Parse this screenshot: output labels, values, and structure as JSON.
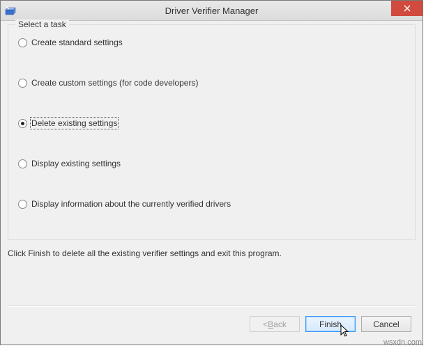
{
  "window": {
    "title": "Driver Verifier Manager"
  },
  "group": {
    "legend": "Select a task"
  },
  "options": {
    "create_standard": "Create standard settings",
    "create_custom": "Create custom settings (for code developers)",
    "delete_existing": "Delete existing settings",
    "display_existing": "Display existing settings",
    "display_info": "Display information about the currently verified drivers",
    "selected": "delete_existing"
  },
  "help": "Click Finish to delete all the existing verifier settings and exit this program.",
  "buttons": {
    "back_prefix": "< ",
    "back_underline": "B",
    "back_suffix": "ack",
    "finish": "Finish",
    "cancel": "Cancel"
  },
  "watermark": "wsxdn.com"
}
